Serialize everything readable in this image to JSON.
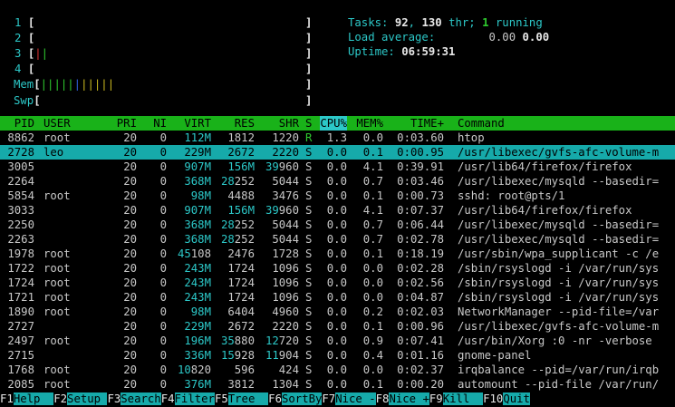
{
  "meters": [
    {
      "label": "1",
      "open": "[",
      "bars": "",
      "close": "]"
    },
    {
      "label": "2",
      "open": "[",
      "bars": "",
      "close": "]"
    },
    {
      "label": "3",
      "open": "[",
      "bars": "||",
      "close": "]"
    },
    {
      "label": "4",
      "open": "[",
      "bars": "",
      "close": "]"
    },
    {
      "label": "Mem",
      "open": "[",
      "bars": "|||||||||||",
      "close": "]"
    },
    {
      "label": "Swp",
      "open": "[",
      "bars": "",
      "close": "]"
    }
  ],
  "summary": {
    "tasks_label": "Tasks: ",
    "tasks_count": "92",
    "threads": "130",
    "thr_label": " thr; ",
    "running_count": "1",
    "running_label": " running",
    "load_label": "Load average: ",
    "load_1": "0.00",
    "load_5": "0.00",
    "uptime_label": "Uptime: ",
    "uptime_value": "06:59:31"
  },
  "columns": [
    "PID",
    "USER",
    "PRI",
    "NI",
    "VIRT",
    "RES",
    "SHR",
    "S",
    "CPU%",
    "MEM%",
    "TIME+",
    "Command"
  ],
  "processes": [
    {
      "pid": "8862",
      "user": "root",
      "pri": "20",
      "ni": "0",
      "virt": "112M",
      "res": "1812",
      "shr": "1220",
      "s": "R",
      "cpu": "1.3",
      "mem": "0.0",
      "time": "0:03.60",
      "cmd": "htop"
    },
    {
      "pid": "2728",
      "user": "leo",
      "pri": "20",
      "ni": "0",
      "virt": "229M",
      "res": "2672",
      "shr": "2220",
      "s": "S",
      "cpu": "0.0",
      "mem": "0.1",
      "time": "0:00.95",
      "cmd": "/usr/libexec/gvfs-afc-volume-m"
    },
    {
      "pid": "3005",
      "user": "",
      "pri": "20",
      "ni": "0",
      "virt": "907M",
      "res": "156M",
      "shr": "39960",
      "s": "S",
      "cpu": "0.0",
      "mem": "4.1",
      "time": "0:39.91",
      "cmd": "/usr/lib64/firefox/firefox"
    },
    {
      "pid": "2264",
      "user": "",
      "pri": "20",
      "ni": "0",
      "virt": "368M",
      "res": "28252",
      "shr": "5044",
      "s": "S",
      "cpu": "0.0",
      "mem": "0.7",
      "time": "0:03.46",
      "cmd": "/usr/libexec/mysqld --basedir="
    },
    {
      "pid": "5854",
      "user": "root",
      "pri": "20",
      "ni": "0",
      "virt": "98M",
      "res": "4488",
      "shr": "3476",
      "s": "S",
      "cpu": "0.0",
      "mem": "0.1",
      "time": "0:00.73",
      "cmd": "sshd: root@pts/1"
    },
    {
      "pid": "3033",
      "user": "",
      "pri": "20",
      "ni": "0",
      "virt": "907M",
      "res": "156M",
      "shr": "39960",
      "s": "S",
      "cpu": "0.0",
      "mem": "4.1",
      "time": "0:07.37",
      "cmd": "/usr/lib64/firefox/firefox"
    },
    {
      "pid": "2250",
      "user": "",
      "pri": "20",
      "ni": "0",
      "virt": "368M",
      "res": "28252",
      "shr": "5044",
      "s": "S",
      "cpu": "0.0",
      "mem": "0.7",
      "time": "0:06.44",
      "cmd": "/usr/libexec/mysqld --basedir="
    },
    {
      "pid": "2263",
      "user": "",
      "pri": "20",
      "ni": "0",
      "virt": "368M",
      "res": "28252",
      "shr": "5044",
      "s": "S",
      "cpu": "0.0",
      "mem": "0.7",
      "time": "0:02.78",
      "cmd": "/usr/libexec/mysqld --basedir="
    },
    {
      "pid": "1978",
      "user": "root",
      "pri": "20",
      "ni": "0",
      "virt": "45108",
      "res": "2476",
      "shr": "1728",
      "s": "S",
      "cpu": "0.0",
      "mem": "0.1",
      "time": "0:18.19",
      "cmd": "/usr/sbin/wpa_supplicant -c /e"
    },
    {
      "pid": "1722",
      "user": "root",
      "pri": "20",
      "ni": "0",
      "virt": "243M",
      "res": "1724",
      "shr": "1096",
      "s": "S",
      "cpu": "0.0",
      "mem": "0.0",
      "time": "0:02.28",
      "cmd": "/sbin/rsyslogd -i /var/run/sys"
    },
    {
      "pid": "1724",
      "user": "root",
      "pri": "20",
      "ni": "0",
      "virt": "243M",
      "res": "1724",
      "shr": "1096",
      "s": "S",
      "cpu": "0.0",
      "mem": "0.0",
      "time": "0:02.56",
      "cmd": "/sbin/rsyslogd -i /var/run/sys"
    },
    {
      "pid": "1721",
      "user": "root",
      "pri": "20",
      "ni": "0",
      "virt": "243M",
      "res": "1724",
      "shr": "1096",
      "s": "S",
      "cpu": "0.0",
      "mem": "0.0",
      "time": "0:04.87",
      "cmd": "/sbin/rsyslogd -i /var/run/sys"
    },
    {
      "pid": "1890",
      "user": "root",
      "pri": "20",
      "ni": "0",
      "virt": "98M",
      "res": "6404",
      "shr": "4960",
      "s": "S",
      "cpu": "0.0",
      "mem": "0.2",
      "time": "0:02.03",
      "cmd": "NetworkManager --pid-file=/var"
    },
    {
      "pid": "2727",
      "user": "",
      "pri": "20",
      "ni": "0",
      "virt": "229M",
      "res": "2672",
      "shr": "2220",
      "s": "S",
      "cpu": "0.0",
      "mem": "0.1",
      "time": "0:00.96",
      "cmd": "/usr/libexec/gvfs-afc-volume-m"
    },
    {
      "pid": "2497",
      "user": "root",
      "pri": "20",
      "ni": "0",
      "virt": "196M",
      "res": "35880",
      "shr": "12720",
      "s": "S",
      "cpu": "0.0",
      "mem": "0.9",
      "time": "0:07.41",
      "cmd": "/usr/bin/Xorg :0 -nr -verbose"
    },
    {
      "pid": "2715",
      "user": "",
      "pri": "20",
      "ni": "0",
      "virt": "336M",
      "res": "15928",
      "shr": "11904",
      "s": "S",
      "cpu": "0.0",
      "mem": "0.4",
      "time": "0:01.16",
      "cmd": "gnome-panel"
    },
    {
      "pid": "1768",
      "user": "root",
      "pri": "20",
      "ni": "0",
      "virt": "10820",
      "res": "596",
      "shr": "424",
      "s": "S",
      "cpu": "0.0",
      "mem": "0.0",
      "time": "0:02.37",
      "cmd": "irqbalance --pid=/var/run/irqb"
    },
    {
      "pid": "2085",
      "user": "root",
      "pri": "20",
      "ni": "0",
      "virt": "376M",
      "res": "3812",
      "shr": "1304",
      "s": "S",
      "cpu": "0.0",
      "mem": "0.1",
      "time": "0:00.20",
      "cmd": "automount --pid-file /var/run/"
    }
  ],
  "footer": [
    {
      "key": "F1",
      "label": "Help  "
    },
    {
      "key": "F2",
      "label": "Setup "
    },
    {
      "key": "F3",
      "label": "Search"
    },
    {
      "key": "F4",
      "label": "Filter"
    },
    {
      "key": "F5",
      "label": "Tree  "
    },
    {
      "key": "F6",
      "label": "SortBy"
    },
    {
      "key": "F7",
      "label": "Nice -"
    },
    {
      "key": "F8",
      "label": "Nice +"
    },
    {
      "key": "F9",
      "label": "Kill  "
    },
    {
      "key": "F10",
      "label": "Quit"
    }
  ],
  "colors": {
    "header_bg": "#19b219",
    "selection_bg": "#16aaaa",
    "accent": "#2cc8c8"
  }
}
